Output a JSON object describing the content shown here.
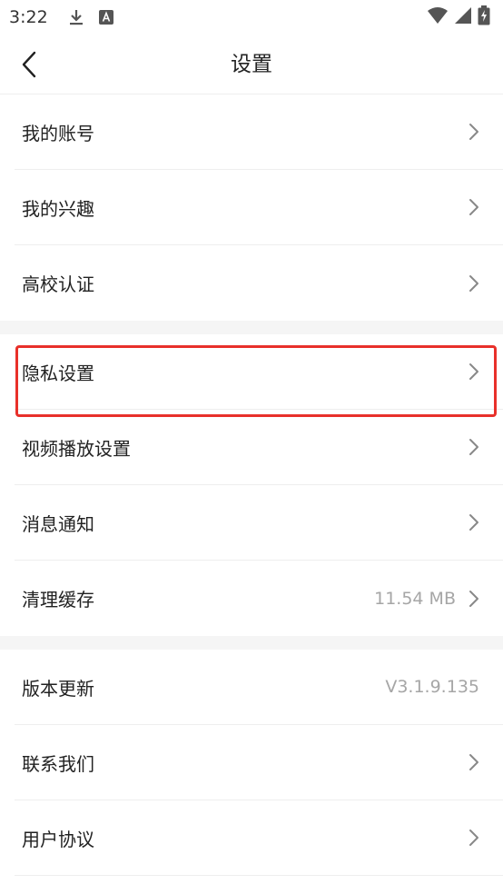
{
  "status_bar": {
    "time": "3:22",
    "icons_left": [
      "download-icon",
      "a-text-notification-icon"
    ],
    "icons_right": [
      "wifi-icon",
      "cell-signal-icon",
      "battery-charging-icon"
    ]
  },
  "header": {
    "title": "设置",
    "back_icon": "chevron-left-icon"
  },
  "groups": [
    {
      "items": [
        {
          "label": "我的账号",
          "value": ""
        },
        {
          "label": "我的兴趣",
          "value": ""
        },
        {
          "label": "高校认证",
          "value": ""
        }
      ]
    },
    {
      "items": [
        {
          "label": "隐私设置",
          "value": ""
        },
        {
          "label": "视频播放设置",
          "value": ""
        },
        {
          "label": "消息通知",
          "value": ""
        },
        {
          "label": "清理缓存",
          "value": "11.54 MB"
        }
      ]
    },
    {
      "items": [
        {
          "label": "版本更新",
          "value": "V3.1.9.135"
        },
        {
          "label": "联系我们",
          "value": ""
        },
        {
          "label": "用户协议",
          "value": ""
        }
      ]
    }
  ],
  "colors": {
    "highlight": "#e8302a",
    "divider": "#eeeeee",
    "group_gap": "#f5f5f5",
    "secondary_text": "#a6a6a6"
  }
}
